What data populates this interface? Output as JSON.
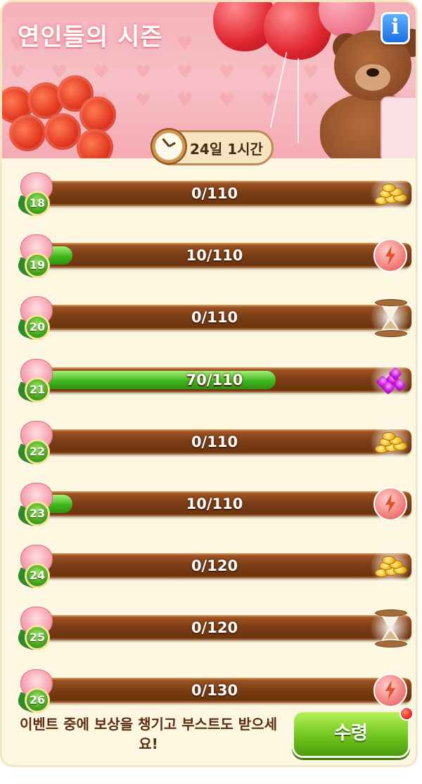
{
  "event": {
    "title": "연인들의 시즌",
    "timer": "24일 1시간",
    "info_label": "i"
  },
  "levels": [
    {
      "level": "18",
      "progress": "0/110",
      "fill": 0.0,
      "reward": "coins-icon"
    },
    {
      "level": "19",
      "progress": "10/110",
      "fill": 0.0909,
      "reward": "energy-icon"
    },
    {
      "level": "20",
      "progress": "0/110",
      "fill": 0.0,
      "reward": "hourglass-icon"
    },
    {
      "level": "21",
      "progress": "70/110",
      "fill": 0.636,
      "reward": "gems-icon"
    },
    {
      "level": "22",
      "progress": "0/110",
      "fill": 0.0,
      "reward": "coins-icon"
    },
    {
      "level": "23",
      "progress": "10/110",
      "fill": 0.0909,
      "reward": "energy-icon"
    },
    {
      "level": "24",
      "progress": "0/120",
      "fill": 0.0,
      "reward": "coins-icon"
    },
    {
      "level": "25",
      "progress": "0/120",
      "fill": 0.0,
      "reward": "hourglass-icon"
    },
    {
      "level": "26",
      "progress": "0/130",
      "fill": 0.0,
      "reward": "energy-icon"
    }
  ],
  "footer": {
    "message": "이벤트 중에 보상을 챙기고 부스트도 받으세요!",
    "claim_label": "수령"
  },
  "colors": {
    "progress_fill": "#3fb81b",
    "bar_wood": "#7a3d14",
    "panel_bg": "#fdf6e0"
  }
}
